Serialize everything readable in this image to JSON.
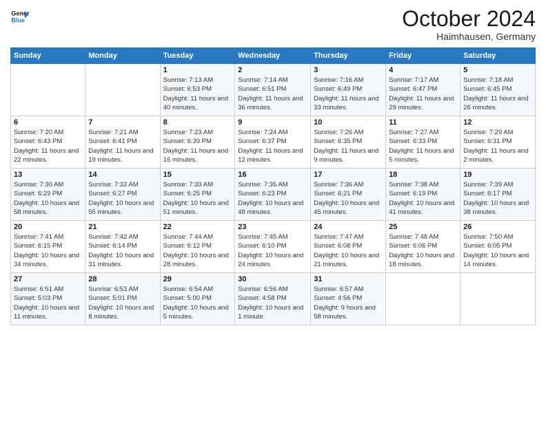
{
  "logo": {
    "line1": "General",
    "line2": "Blue"
  },
  "title": "October 2024",
  "subtitle": "Haimhausen, Germany",
  "days_of_week": [
    "Sunday",
    "Monday",
    "Tuesday",
    "Wednesday",
    "Thursday",
    "Friday",
    "Saturday"
  ],
  "weeks": [
    [
      {
        "day": "",
        "info": ""
      },
      {
        "day": "",
        "info": ""
      },
      {
        "day": "1",
        "info": "Sunrise: 7:13 AM\nSunset: 6:53 PM\nDaylight: 11 hours and 40 minutes."
      },
      {
        "day": "2",
        "info": "Sunrise: 7:14 AM\nSunset: 6:51 PM\nDaylight: 11 hours and 36 minutes."
      },
      {
        "day": "3",
        "info": "Sunrise: 7:16 AM\nSunset: 6:49 PM\nDaylight: 11 hours and 33 minutes."
      },
      {
        "day": "4",
        "info": "Sunrise: 7:17 AM\nSunset: 6:47 PM\nDaylight: 11 hours and 29 minutes."
      },
      {
        "day": "5",
        "info": "Sunrise: 7:18 AM\nSunset: 6:45 PM\nDaylight: 11 hours and 26 minutes."
      }
    ],
    [
      {
        "day": "6",
        "info": "Sunrise: 7:20 AM\nSunset: 6:43 PM\nDaylight: 11 hours and 22 minutes."
      },
      {
        "day": "7",
        "info": "Sunrise: 7:21 AM\nSunset: 6:41 PM\nDaylight: 11 hours and 19 minutes."
      },
      {
        "day": "8",
        "info": "Sunrise: 7:23 AM\nSunset: 6:39 PM\nDaylight: 11 hours and 16 minutes."
      },
      {
        "day": "9",
        "info": "Sunrise: 7:24 AM\nSunset: 6:37 PM\nDaylight: 11 hours and 12 minutes."
      },
      {
        "day": "10",
        "info": "Sunrise: 7:26 AM\nSunset: 6:35 PM\nDaylight: 11 hours and 9 minutes."
      },
      {
        "day": "11",
        "info": "Sunrise: 7:27 AM\nSunset: 6:33 PM\nDaylight: 11 hours and 5 minutes."
      },
      {
        "day": "12",
        "info": "Sunrise: 7:29 AM\nSunset: 6:31 PM\nDaylight: 11 hours and 2 minutes."
      }
    ],
    [
      {
        "day": "13",
        "info": "Sunrise: 7:30 AM\nSunset: 6:29 PM\nDaylight: 10 hours and 58 minutes."
      },
      {
        "day": "14",
        "info": "Sunrise: 7:32 AM\nSunset: 6:27 PM\nDaylight: 10 hours and 55 minutes."
      },
      {
        "day": "15",
        "info": "Sunrise: 7:33 AM\nSunset: 6:25 PM\nDaylight: 10 hours and 51 minutes."
      },
      {
        "day": "16",
        "info": "Sunrise: 7:35 AM\nSunset: 6:23 PM\nDaylight: 10 hours and 48 minutes."
      },
      {
        "day": "17",
        "info": "Sunrise: 7:36 AM\nSunset: 6:21 PM\nDaylight: 10 hours and 45 minutes."
      },
      {
        "day": "18",
        "info": "Sunrise: 7:38 AM\nSunset: 6:19 PM\nDaylight: 10 hours and 41 minutes."
      },
      {
        "day": "19",
        "info": "Sunrise: 7:39 AM\nSunset: 6:17 PM\nDaylight: 10 hours and 38 minutes."
      }
    ],
    [
      {
        "day": "20",
        "info": "Sunrise: 7:41 AM\nSunset: 6:15 PM\nDaylight: 10 hours and 34 minutes."
      },
      {
        "day": "21",
        "info": "Sunrise: 7:42 AM\nSunset: 6:14 PM\nDaylight: 10 hours and 31 minutes."
      },
      {
        "day": "22",
        "info": "Sunrise: 7:44 AM\nSunset: 6:12 PM\nDaylight: 10 hours and 28 minutes."
      },
      {
        "day": "23",
        "info": "Sunrise: 7:45 AM\nSunset: 6:10 PM\nDaylight: 10 hours and 24 minutes."
      },
      {
        "day": "24",
        "info": "Sunrise: 7:47 AM\nSunset: 6:08 PM\nDaylight: 10 hours and 21 minutes."
      },
      {
        "day": "25",
        "info": "Sunrise: 7:48 AM\nSunset: 6:06 PM\nDaylight: 10 hours and 18 minutes."
      },
      {
        "day": "26",
        "info": "Sunrise: 7:50 AM\nSunset: 6:05 PM\nDaylight: 10 hours and 14 minutes."
      }
    ],
    [
      {
        "day": "27",
        "info": "Sunrise: 6:51 AM\nSunset: 5:03 PM\nDaylight: 10 hours and 11 minutes."
      },
      {
        "day": "28",
        "info": "Sunrise: 6:53 AM\nSunset: 5:01 PM\nDaylight: 10 hours and 8 minutes."
      },
      {
        "day": "29",
        "info": "Sunrise: 6:54 AM\nSunset: 5:00 PM\nDaylight: 10 hours and 5 minutes."
      },
      {
        "day": "30",
        "info": "Sunrise: 6:56 AM\nSunset: 4:58 PM\nDaylight: 10 hours and 1 minute."
      },
      {
        "day": "31",
        "info": "Sunrise: 6:57 AM\nSunset: 4:56 PM\nDaylight: 9 hours and 58 minutes."
      },
      {
        "day": "",
        "info": ""
      },
      {
        "day": "",
        "info": ""
      }
    ]
  ]
}
